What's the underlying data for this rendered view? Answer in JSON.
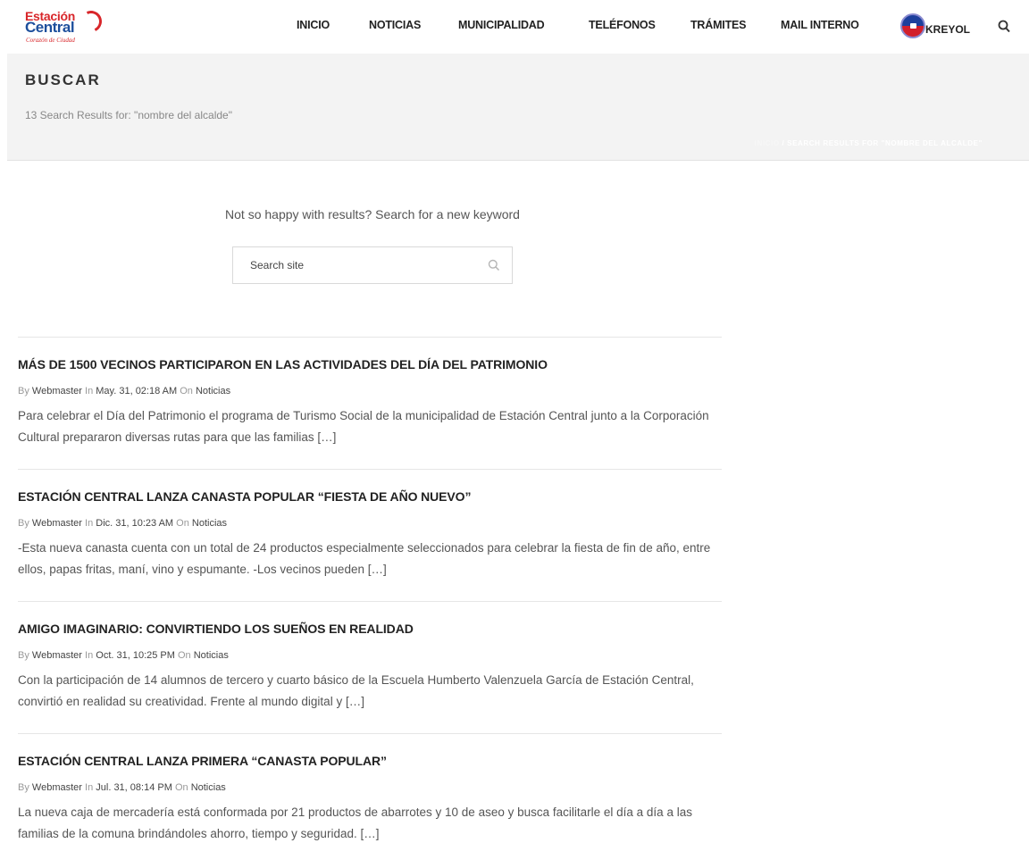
{
  "logo": {
    "line1": "Estación",
    "line2": "Central",
    "tagline": "Corazón de Ciudad"
  },
  "nav": {
    "items": [
      {
        "label": "INICIO"
      },
      {
        "label": "NOTICIAS"
      },
      {
        "label": "MUNICIPALIDAD"
      },
      {
        "label": "TELÉFONOS"
      },
      {
        "label": "TRÁMITES"
      },
      {
        "label": "MAIL INTERNO"
      }
    ],
    "language_label": "KREYOL",
    "flag_icon": "haiti-flag-icon",
    "search_icon": "search-icon"
  },
  "title_band": {
    "title": "BUSCAR",
    "subtitle": "13 Search Results for: \"nombre del alcalde\"",
    "breadcrumb_home": "INICIO",
    "breadcrumb_current": "/ SEARCH RESULTS FOR \"NOMBRE DEL ALCALDE\""
  },
  "search": {
    "prompt": "Not so happy with results? Search for a new keyword",
    "placeholder": "Search site",
    "value": ""
  },
  "results": [
    {
      "title": "MÁS DE 1500 VECINOS PARTICIPARON EN LAS ACTIVIDADES DEL DÍA DEL PATRIMONIO",
      "by": "By",
      "author": "Webmaster",
      "in": "In",
      "date": "May. 31, 02:18 AM",
      "on": "On",
      "category": "Noticias",
      "excerpt": "Para celebrar el Día del Patrimonio el programa de Turismo Social de la municipalidad de Estación Central junto a la Corporación Cultural prepararon diversas rutas para que las familias […]"
    },
    {
      "title": "ESTACIÓN CENTRAL LANZA CANASTA POPULAR “FIESTA DE AÑO NUEVO”",
      "by": "By",
      "author": "Webmaster",
      "in": "In",
      "date": "Dic. 31, 10:23 AM",
      "on": "On",
      "category": "Noticias",
      "excerpt": "-Esta nueva canasta cuenta con un total de 24 productos especialmente seleccionados para celebrar la fiesta de fin de año, entre ellos, papas fritas, maní, vino y espumante. -Los vecinos pueden […]"
    },
    {
      "title": "AMIGO IMAGINARIO: CONVIRTIENDO LOS SUEÑOS EN REALIDAD",
      "by": "By",
      "author": "Webmaster",
      "in": "In",
      "date": "Oct. 31, 10:25 PM",
      "on": "On",
      "category": "Noticias",
      "excerpt": "Con la participación de 14 alumnos de tercero y cuarto básico de la Escuela Humberto Valenzuela García de Estación Central, convirtió en realidad su creatividad. Frente al mundo digital y […]"
    },
    {
      "title": "ESTACIÓN CENTRAL LANZA PRIMERA “CANASTA POPULAR”",
      "by": "By",
      "author": "Webmaster",
      "in": "In",
      "date": "Jul. 31, 08:14 PM",
      "on": "On",
      "category": "Noticias",
      "excerpt": "La nueva caja de mercadería está conformada por 21 productos de abarrotes y 10 de aseo y busca facilitarle el día a día a las familias de la comuna brindándoles ahorro, tiempo y seguridad.   […]"
    }
  ],
  "colors": {
    "brand_red": "#d8262a",
    "brand_blue": "#1d4f9c",
    "band_bg": "#f3f3f3"
  }
}
